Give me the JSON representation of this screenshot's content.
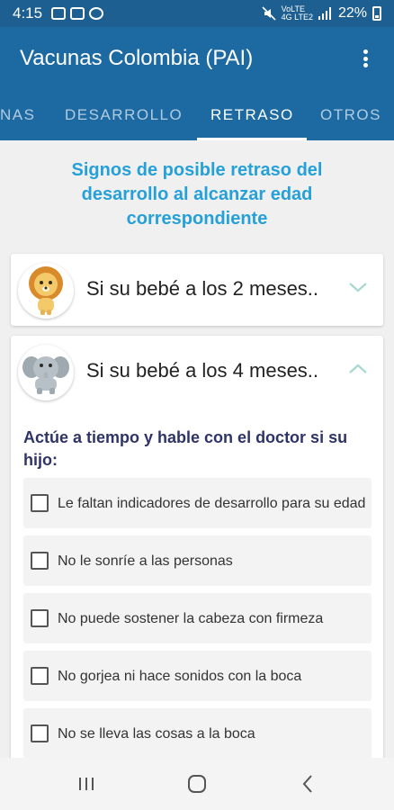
{
  "status_bar": {
    "time": "4:15",
    "network_top": "VoLTE",
    "network_bottom": "4G LTE2",
    "battery": "22%"
  },
  "app_bar": {
    "title": "Vacunas Colombia (PAI)"
  },
  "tabs": [
    {
      "label": "NAS",
      "active": false
    },
    {
      "label": "DESARROLLO",
      "active": false
    },
    {
      "label": "RETRASO",
      "active": true
    },
    {
      "label": "OTROS",
      "active": false
    }
  ],
  "headline": "Signos de posible retraso del desarrollo al alcanzar edad correspondiente",
  "sections": [
    {
      "title": "Si su bebé a los 2 meses..",
      "expanded": false,
      "avatar_icon": "lion-icon"
    },
    {
      "title": "Si su bebé a los 4 meses..",
      "expanded": true,
      "avatar_icon": "elephant-icon"
    }
  ],
  "expanded_section": {
    "subheading": "Actúe a tiempo y hable con el doctor si su hijo:",
    "items": [
      {
        "label": "Le faltan indicadores de desarrollo para su edad",
        "checked": false
      },
      {
        "label": "No le sonríe a las personas",
        "checked": false
      },
      {
        "label": "No puede sostener la cabeza con firmeza",
        "checked": false
      },
      {
        "label": "No gorjea ni hace sonidos con la boca",
        "checked": false
      },
      {
        "label": "No se lleva las cosas a la boca",
        "checked": false
      }
    ]
  },
  "nav_bar": {
    "icons": [
      "recents-icon",
      "home-icon",
      "back-icon"
    ]
  },
  "colors": {
    "primary": "#1d6aa3",
    "status_bar": "#1d5f91",
    "headline": "#25a0d8",
    "subheading": "#2e3368",
    "chevron": "#a8d8cf"
  }
}
